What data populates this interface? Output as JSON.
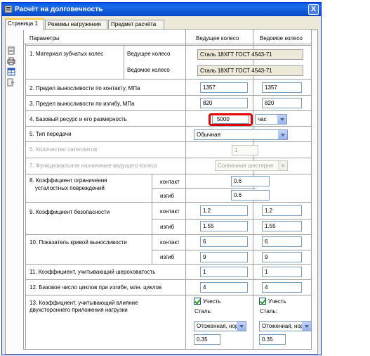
{
  "window": {
    "title": "Расчёт на долговечность",
    "close_symbol": "X"
  },
  "tabs": [
    {
      "label": "Страница 1",
      "active": true
    },
    {
      "label": "Режимы нагружения",
      "active": false
    },
    {
      "label": "Предмет расчёта",
      "active": false
    }
  ],
  "side_toolbar": [
    "document-icon",
    "print-icon",
    "table-icon",
    "export-icon"
  ],
  "header": {
    "params": "Параметры",
    "drive": "Ведущее колесо",
    "driven": "Ведомое колесо"
  },
  "rows": {
    "r1": {
      "label": "1. Материал зубчатых колес",
      "sub1": "Ведущее колесо",
      "sub2": "Ведомое колесо",
      "val1": "Сталь 18ХГТ ГОСТ 4543-71",
      "val2": "Сталь 18ХГТ ГОСТ 4543-71"
    },
    "r2": {
      "label": "2. Предел выносливости по контакту, МПа",
      "drive": "1357",
      "driven": "1357"
    },
    "r3": {
      "label": "3. Предел выносливости по изгибу, МПа",
      "drive": "820",
      "driven": "820"
    },
    "r4": {
      "label": "4. Базовый ресурс и его размерность",
      "value": "5000",
      "unit": "час"
    },
    "r5": {
      "label": "5. Тип передачи",
      "value": "Обычная"
    },
    "r6": {
      "label": "6. Количество сателлитов",
      "value": "1"
    },
    "r7": {
      "label": "7. Функциональное назначение ведущего колеса",
      "value": "Солнечная шестерня"
    },
    "r8": {
      "label_line1": "8. Коэффициент ограничения",
      "label_line2": "усталостных повреждений",
      "sub1": "контакт",
      "sub2": "изгиб",
      "val1": "0.6",
      "val2": "0.6"
    },
    "r9": {
      "label": "9. Коэффициент безопасности",
      "sub1": "контакт",
      "sub2": "изгиб",
      "drive1": "1.2",
      "driven1": "1.2",
      "drive2": "1.55",
      "driven2": "1.55"
    },
    "r10": {
      "label": "10. Показатель кривой выносливости",
      "sub1": "контакт",
      "sub2": "изгиб",
      "drive1": "6",
      "driven1": "6",
      "drive2": "9",
      "driven2": "9"
    },
    "r11": {
      "label": "11. Коэффициент, учитывающий шероховатость",
      "drive": "1",
      "driven": "1"
    },
    "r12": {
      "label": "12. Базовое число циклов при изгибе, млн. циклов",
      "drive": "4",
      "driven": "4"
    },
    "r13": {
      "label_line1": "13. Коэффициент, учитывающий влияние",
      "label_line2": "двухстороннего приложения нагрузки",
      "check_label": "Учесть",
      "steel_label": "Сталь:",
      "steel_value": "Отоженная, нор",
      "coef_drive": "0.35",
      "coef_driven": "0.35"
    }
  }
}
